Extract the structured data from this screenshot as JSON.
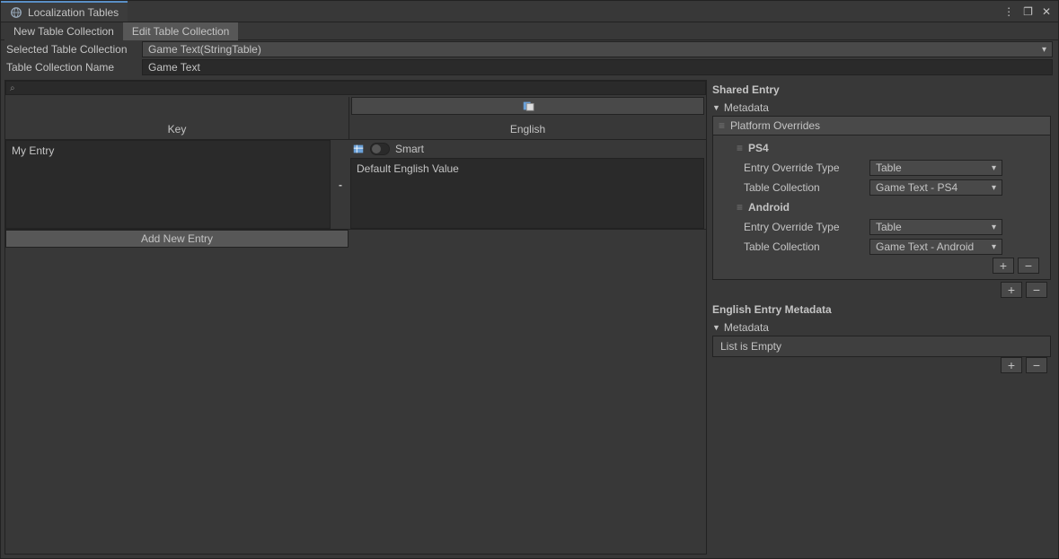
{
  "window": {
    "title": "Localization Tables"
  },
  "tabs": {
    "new": "New Table Collection",
    "edit": "Edit Table Collection"
  },
  "fields": {
    "selected_label": "Selected Table Collection",
    "selected_value": "Game Text(StringTable)",
    "name_label": "Table Collection Name",
    "name_value": "Game Text"
  },
  "table": {
    "headers": {
      "key": "Key",
      "lang": "English"
    },
    "entry": {
      "key": "My Entry",
      "smart_label": "Smart",
      "value": "Default English Value"
    },
    "add_label": "Add New Entry",
    "dash": "-"
  },
  "shared": {
    "title": "Shared Entry",
    "metadata_label": "Metadata",
    "platform_overrides": "Platform Overrides",
    "platforms": {
      "ps4": {
        "name": "PS4",
        "override_type_label": "Entry Override Type",
        "override_type_value": "Table",
        "collection_label": "Table Collection",
        "collection_value": "Game Text - PS4"
      },
      "android": {
        "name": "Android",
        "override_type_label": "Entry Override Type",
        "override_type_value": "Table",
        "collection_label": "Table Collection",
        "collection_value": "Game Text - Android"
      }
    }
  },
  "english_meta": {
    "title": "English Entry Metadata",
    "metadata_label": "Metadata",
    "empty": "List is Empty"
  },
  "icons": {
    "plus": "+",
    "minus": "−",
    "menu": "⋮",
    "max": "❐",
    "close": "✕",
    "search": "⌕"
  }
}
